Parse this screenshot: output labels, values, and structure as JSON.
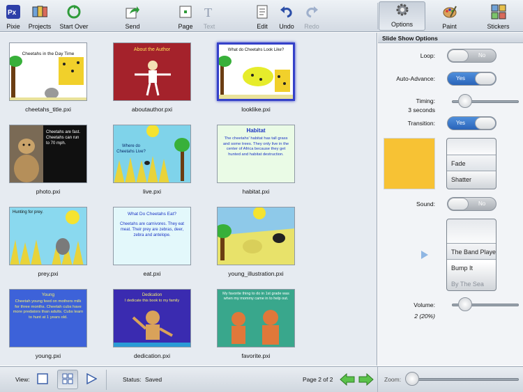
{
  "toolbar": {
    "left": [
      {
        "label": "Pixie",
        "icon": "pixie-logo-icon"
      },
      {
        "label": "Projects",
        "icon": "projects-icon"
      },
      {
        "label": "Start Over",
        "icon": "start-over-icon"
      },
      {
        "label": "Send",
        "icon": "send-icon"
      },
      {
        "label": "Page",
        "icon": "page-icon"
      },
      {
        "label": "Text",
        "icon": "text-icon"
      },
      {
        "label": "Edit",
        "icon": "edit-icon"
      },
      {
        "label": "Undo",
        "icon": "undo-icon"
      },
      {
        "label": "Redo",
        "icon": "redo-icon"
      }
    ],
    "right": [
      {
        "label": "Options",
        "icon": "options-gear-icon"
      },
      {
        "label": "Paint",
        "icon": "paint-palette-icon"
      },
      {
        "label": "Stickers",
        "icon": "stickers-icon"
      }
    ]
  },
  "gallery": {
    "items": [
      {
        "file": "cheetahs_title.pxi",
        "text": "Cheetahs in the Day Time"
      },
      {
        "file": "aboutauthor.pxi",
        "text": "About the Author"
      },
      {
        "file": "looklike.pxi",
        "text": "What do Cheetahs Look Like?"
      },
      {
        "file": "photo.pxi",
        "text": "Cheetahs are fast. Cheetahs can run to 70 mph."
      },
      {
        "file": "live.pxi",
        "text": "Where do Cheetahs Live?"
      },
      {
        "file": "habitat.pxi",
        "title": "Habitat",
        "text": "The cheetahs' habitat has tall grass and some trees. They only live in the center of Africa because they get hunted and habitat destruction."
      },
      {
        "file": "prey.pxi",
        "text": "Hunting for prey."
      },
      {
        "file": "eat.pxi",
        "title": "What Do Cheetahs Eat?",
        "text": "Cheetahs are carnivores. They eat meat. Their prey are zebras, deer, zebra and antelope."
      },
      {
        "file": "young_illustration.pxi",
        "text": ""
      },
      {
        "file": "young.pxi",
        "title": "Young",
        "text": "Cheetah young feed on mothers milk for three months. Cheetah cubs have more predators than adults. Cubs learn to hunt at 1 years old."
      },
      {
        "file": "dedication.pxi",
        "title": "Dedication",
        "text": "I dedicate this book to my family"
      },
      {
        "file": "favorite.pxi",
        "text": "My favorite thing to do in 1st grade was when my mommy came in to help out."
      }
    ]
  },
  "panel": {
    "title": "Slide Show Options",
    "loop_label": "Loop:",
    "loop_state": "No",
    "auto_label": "Auto-Advance:",
    "auto_state": "Yes",
    "timing_label": "Timing:",
    "timing_value": "3 seconds",
    "timing_fraction": 0.2,
    "transition_label": "Transition:",
    "transition_state": "Yes",
    "transition_color": "#f7c234",
    "transition_options": [
      "",
      "Fade",
      "Shatter"
    ],
    "sound_label": "Sound:",
    "sound_state": "No",
    "sound_options": [
      "",
      "The Band Playe...",
      "Bump It",
      "By The Sea"
    ],
    "volume_label": "Volume:",
    "volume_value": "2 (20%)",
    "volume_fraction": 0.2
  },
  "bottom": {
    "view_label": "View:",
    "status_label": "Status:",
    "status_value": "Saved",
    "page_text": "Page 2 of 2",
    "zoom_label": "Zoom:"
  }
}
